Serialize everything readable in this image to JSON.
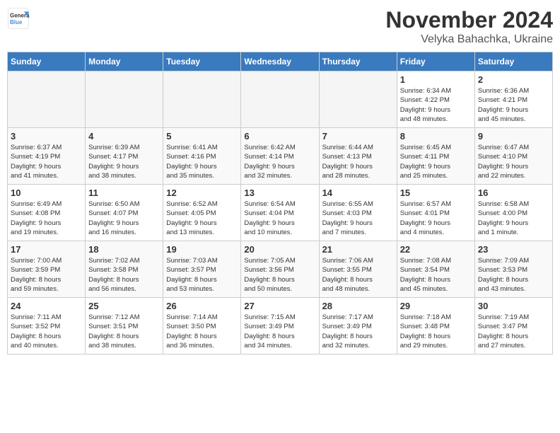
{
  "header": {
    "logo_general": "General",
    "logo_blue": "Blue",
    "month": "November 2024",
    "location": "Velyka Bahachka, Ukraine"
  },
  "days_of_week": [
    "Sunday",
    "Monday",
    "Tuesday",
    "Wednesday",
    "Thursday",
    "Friday",
    "Saturday"
  ],
  "weeks": [
    [
      {
        "day": "",
        "info": ""
      },
      {
        "day": "",
        "info": ""
      },
      {
        "day": "",
        "info": ""
      },
      {
        "day": "",
        "info": ""
      },
      {
        "day": "",
        "info": ""
      },
      {
        "day": "1",
        "info": "Sunrise: 6:34 AM\nSunset: 4:22 PM\nDaylight: 9 hours\nand 48 minutes."
      },
      {
        "day": "2",
        "info": "Sunrise: 6:36 AM\nSunset: 4:21 PM\nDaylight: 9 hours\nand 45 minutes."
      }
    ],
    [
      {
        "day": "3",
        "info": "Sunrise: 6:37 AM\nSunset: 4:19 PM\nDaylight: 9 hours\nand 41 minutes."
      },
      {
        "day": "4",
        "info": "Sunrise: 6:39 AM\nSunset: 4:17 PM\nDaylight: 9 hours\nand 38 minutes."
      },
      {
        "day": "5",
        "info": "Sunrise: 6:41 AM\nSunset: 4:16 PM\nDaylight: 9 hours\nand 35 minutes."
      },
      {
        "day": "6",
        "info": "Sunrise: 6:42 AM\nSunset: 4:14 PM\nDaylight: 9 hours\nand 32 minutes."
      },
      {
        "day": "7",
        "info": "Sunrise: 6:44 AM\nSunset: 4:13 PM\nDaylight: 9 hours\nand 28 minutes."
      },
      {
        "day": "8",
        "info": "Sunrise: 6:45 AM\nSunset: 4:11 PM\nDaylight: 9 hours\nand 25 minutes."
      },
      {
        "day": "9",
        "info": "Sunrise: 6:47 AM\nSunset: 4:10 PM\nDaylight: 9 hours\nand 22 minutes."
      }
    ],
    [
      {
        "day": "10",
        "info": "Sunrise: 6:49 AM\nSunset: 4:08 PM\nDaylight: 9 hours\nand 19 minutes."
      },
      {
        "day": "11",
        "info": "Sunrise: 6:50 AM\nSunset: 4:07 PM\nDaylight: 9 hours\nand 16 minutes."
      },
      {
        "day": "12",
        "info": "Sunrise: 6:52 AM\nSunset: 4:05 PM\nDaylight: 9 hours\nand 13 minutes."
      },
      {
        "day": "13",
        "info": "Sunrise: 6:54 AM\nSunset: 4:04 PM\nDaylight: 9 hours\nand 10 minutes."
      },
      {
        "day": "14",
        "info": "Sunrise: 6:55 AM\nSunset: 4:03 PM\nDaylight: 9 hours\nand 7 minutes."
      },
      {
        "day": "15",
        "info": "Sunrise: 6:57 AM\nSunset: 4:01 PM\nDaylight: 9 hours\nand 4 minutes."
      },
      {
        "day": "16",
        "info": "Sunrise: 6:58 AM\nSunset: 4:00 PM\nDaylight: 9 hours\nand 1 minute."
      }
    ],
    [
      {
        "day": "17",
        "info": "Sunrise: 7:00 AM\nSunset: 3:59 PM\nDaylight: 8 hours\nand 59 minutes."
      },
      {
        "day": "18",
        "info": "Sunrise: 7:02 AM\nSunset: 3:58 PM\nDaylight: 8 hours\nand 56 minutes."
      },
      {
        "day": "19",
        "info": "Sunrise: 7:03 AM\nSunset: 3:57 PM\nDaylight: 8 hours\nand 53 minutes."
      },
      {
        "day": "20",
        "info": "Sunrise: 7:05 AM\nSunset: 3:56 PM\nDaylight: 8 hours\nand 50 minutes."
      },
      {
        "day": "21",
        "info": "Sunrise: 7:06 AM\nSunset: 3:55 PM\nDaylight: 8 hours\nand 48 minutes."
      },
      {
        "day": "22",
        "info": "Sunrise: 7:08 AM\nSunset: 3:54 PM\nDaylight: 8 hours\nand 45 minutes."
      },
      {
        "day": "23",
        "info": "Sunrise: 7:09 AM\nSunset: 3:53 PM\nDaylight: 8 hours\nand 43 minutes."
      }
    ],
    [
      {
        "day": "24",
        "info": "Sunrise: 7:11 AM\nSunset: 3:52 PM\nDaylight: 8 hours\nand 40 minutes."
      },
      {
        "day": "25",
        "info": "Sunrise: 7:12 AM\nSunset: 3:51 PM\nDaylight: 8 hours\nand 38 minutes."
      },
      {
        "day": "26",
        "info": "Sunrise: 7:14 AM\nSunset: 3:50 PM\nDaylight: 8 hours\nand 36 minutes."
      },
      {
        "day": "27",
        "info": "Sunrise: 7:15 AM\nSunset: 3:49 PM\nDaylight: 8 hours\nand 34 minutes."
      },
      {
        "day": "28",
        "info": "Sunrise: 7:17 AM\nSunset: 3:49 PM\nDaylight: 8 hours\nand 32 minutes."
      },
      {
        "day": "29",
        "info": "Sunrise: 7:18 AM\nSunset: 3:48 PM\nDaylight: 8 hours\nand 29 minutes."
      },
      {
        "day": "30",
        "info": "Sunrise: 7:19 AM\nSunset: 3:47 PM\nDaylight: 8 hours\nand 27 minutes."
      }
    ]
  ]
}
